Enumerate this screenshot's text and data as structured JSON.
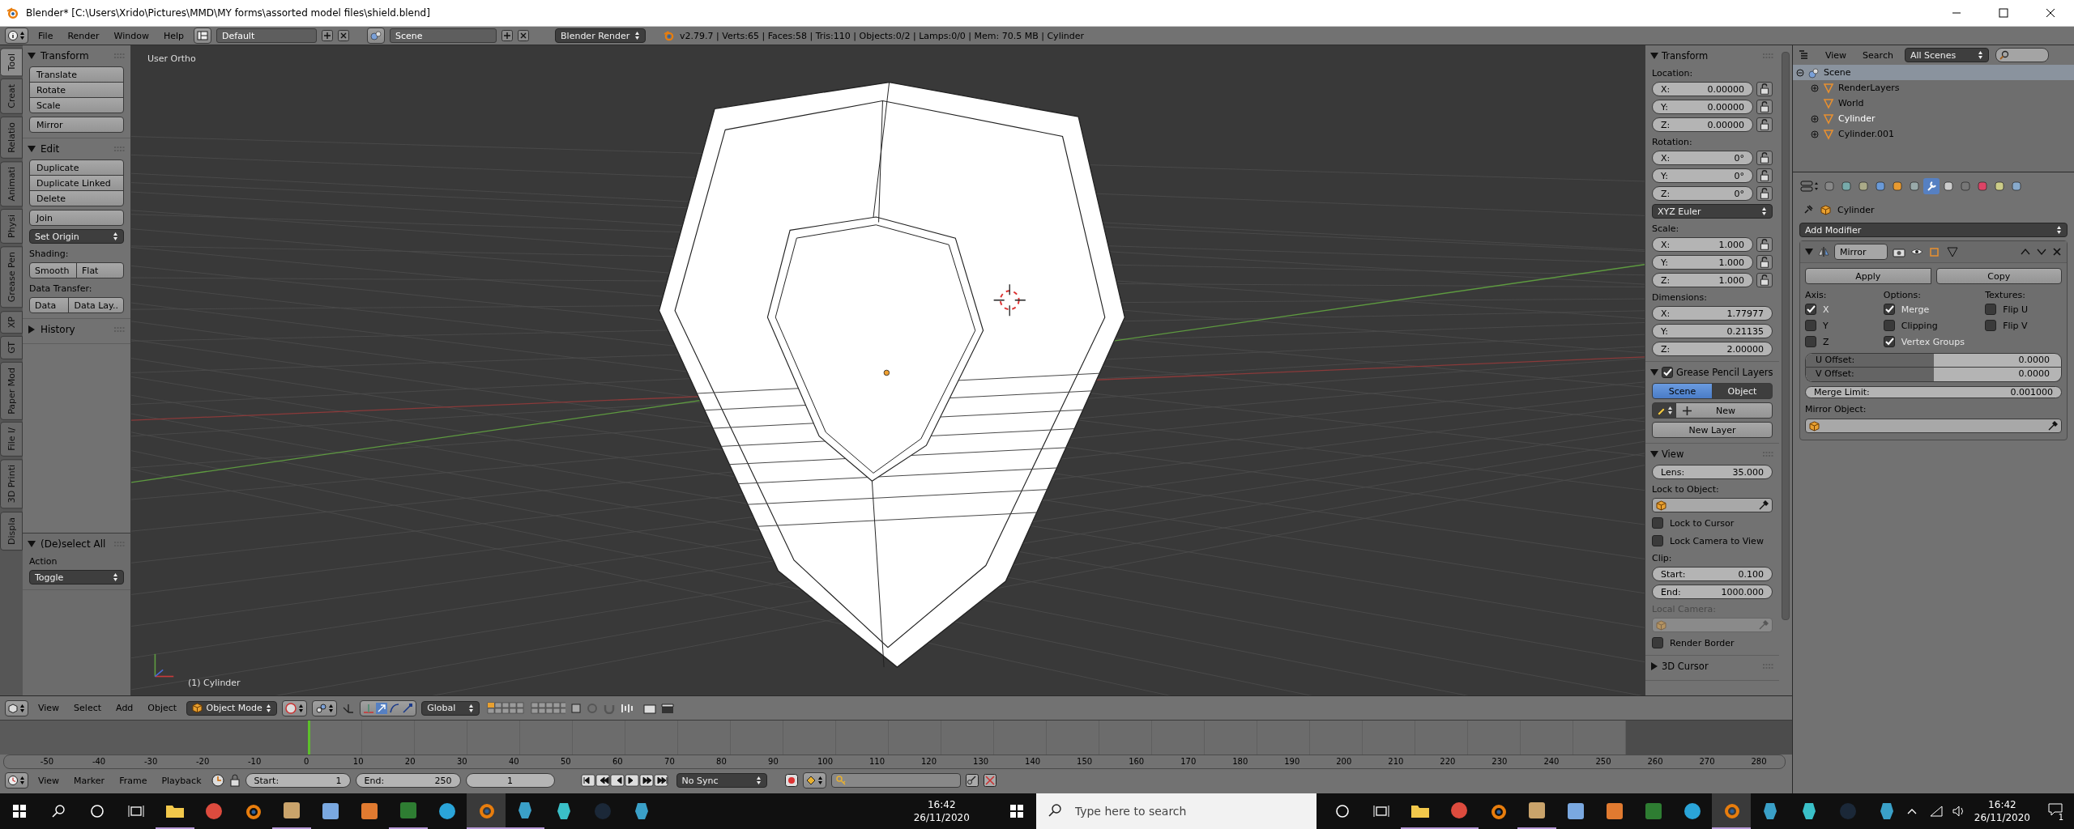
{
  "window": {
    "title": "Blender* [C:\\Users\\Xrido\\Pictures\\MMD\\MY forms\\assorted model files\\shield.blend]"
  },
  "info_header": {
    "menus": [
      "File",
      "Render",
      "Window",
      "Help"
    ],
    "layout": "Default",
    "scene": "Scene",
    "engine": "Blender Render",
    "stats": "v2.79.7 | Verts:65 | Faces:58 | Tris:110 | Objects:0/2 | Lamps:0/0 | Mem: 70.5 MB | Cylinder"
  },
  "tool_tabs": [
    {
      "label": "Tool",
      "selected": true
    },
    {
      "label": "Creat",
      "selected": false
    },
    {
      "label": "Relatio",
      "selected": false
    },
    {
      "label": "Animati",
      "selected": false
    },
    {
      "label": "Physi",
      "selected": false
    },
    {
      "label": "Grease Pen",
      "selected": false
    },
    {
      "label": "XP",
      "selected": false
    },
    {
      "label": "GT",
      "selected": false
    },
    {
      "label": "Paper Mod",
      "selected": false
    },
    {
      "label": "File I/",
      "selected": false
    },
    {
      "label": "3D Printi",
      "selected": false
    },
    {
      "label": "Displa",
      "selected": false
    }
  ],
  "tool_shelf": {
    "panels": [
      {
        "title": "Transform",
        "expanded": true,
        "rows": [
          {
            "kind": "stack",
            "buttons": [
              "Translate",
              "Rotate",
              "Scale"
            ]
          },
          {
            "kind": "button",
            "label": "Mirror"
          }
        ]
      },
      {
        "title": "Edit",
        "expanded": true,
        "rows": [
          {
            "kind": "stack",
            "buttons": [
              "Duplicate",
              "Duplicate Linked",
              "Delete"
            ]
          },
          {
            "kind": "button",
            "label": "Join"
          },
          {
            "kind": "dropdown",
            "label": "Set Origin"
          },
          {
            "kind": "label",
            "text": "Shading:"
          },
          {
            "kind": "pair",
            "buttons": [
              "Smooth",
              "Flat"
            ]
          },
          {
            "kind": "label",
            "text": "Data Transfer:"
          },
          {
            "kind": "pair",
            "buttons": [
              "Data",
              "Data Lay.."
            ]
          }
        ]
      },
      {
        "title": "History",
        "expanded": false
      }
    ],
    "operator": {
      "title": "(De)select All",
      "expanded": true,
      "rows": [
        {
          "kind": "label",
          "text": "Action"
        },
        {
          "kind": "dropdown",
          "label": "Toggle"
        }
      ]
    }
  },
  "viewport": {
    "view_name": "User Ortho",
    "object_info": "(1) Cylinder"
  },
  "n_panel": {
    "panels": [
      {
        "title": "Transform",
        "expanded": true,
        "rows": [
          {
            "kind": "label",
            "text": "Location:"
          },
          {
            "kind": "field",
            "label": "X:",
            "value": "0.00000",
            "locked": false
          },
          {
            "kind": "field",
            "label": "Y:",
            "value": "0.00000",
            "locked": false
          },
          {
            "kind": "field",
            "label": "Z:",
            "value": "0.00000",
            "locked": false
          },
          {
            "kind": "label",
            "text": "Rotation:"
          },
          {
            "kind": "field",
            "label": "X:",
            "value": "0°",
            "locked": false
          },
          {
            "kind": "field",
            "label": "Y:",
            "value": "0°",
            "locked": false
          },
          {
            "kind": "field",
            "label": "Z:",
            "value": "0°",
            "locked": false
          },
          {
            "kind": "dropdown",
            "label": "XYZ Euler"
          },
          {
            "kind": "label",
            "text": "Scale:"
          },
          {
            "kind": "field",
            "label": "X:",
            "value": "1.000",
            "locked": false
          },
          {
            "kind": "field",
            "label": "Y:",
            "value": "1.000",
            "locked": false
          },
          {
            "kind": "field",
            "label": "Z:",
            "value": "1.000",
            "locked": false
          },
          {
            "kind": "label",
            "text": "Dimensions:"
          },
          {
            "kind": "field",
            "label": "X:",
            "value": "1.77977"
          },
          {
            "kind": "field",
            "label": "Y:",
            "value": "0.21135"
          },
          {
            "kind": "field",
            "label": "Z:",
            "value": "2.00000"
          }
        ]
      },
      {
        "title": "Grease Pencil Layers",
        "expanded": true,
        "checked": true,
        "rows": [
          {
            "kind": "segmented",
            "options": [
              {
                "label": "Scene",
                "selected": true
              },
              {
                "label": "Object",
                "selected": false
              }
            ]
          },
          {
            "kind": "new",
            "label": "New"
          },
          {
            "kind": "button",
            "label": "New Layer"
          }
        ]
      },
      {
        "title": "View",
        "expanded": true,
        "rows": [
          {
            "kind": "field",
            "label": "Lens:",
            "value": "35.000"
          },
          {
            "kind": "label",
            "text": "Lock to Object:"
          },
          {
            "kind": "object",
            "disabled": false
          },
          {
            "kind": "checkbox",
            "label": "Lock to Cursor",
            "checked": false
          },
          {
            "kind": "checkbox",
            "label": "Lock Camera to View",
            "checked": false
          },
          {
            "kind": "label",
            "text": "Clip:"
          },
          {
            "kind": "field",
            "label": "Start:",
            "value": "0.100"
          },
          {
            "kind": "field",
            "label": "End:",
            "value": "1000.000"
          },
          {
            "kind": "label",
            "text": "Local Camera:",
            "disabled": true
          },
          {
            "kind": "object",
            "disabled": true
          },
          {
            "kind": "checkbox",
            "label": "Render Border",
            "checked": false
          }
        ]
      },
      {
        "title": "3D Cursor",
        "expanded": false
      }
    ]
  },
  "outliner": {
    "menus": [
      "View",
      "Search"
    ],
    "filter": "All Scenes",
    "tree": [
      {
        "label": "Scene",
        "selected": true,
        "active": false,
        "expanded": true,
        "children": [
          {
            "label": "RenderLayers",
            "selected": false,
            "active": false,
            "expanded": false
          },
          {
            "label": "World",
            "selected": false,
            "active": false
          },
          {
            "label": "Cylinder",
            "selected": false,
            "active": true,
            "expanded": false
          },
          {
            "label": "Cylinder.001",
            "selected": false,
            "active": false,
            "expanded": false
          }
        ]
      }
    ]
  },
  "properties": {
    "tabs": [
      {
        "selected": false
      },
      {
        "selected": false
      },
      {
        "selected": false
      },
      {
        "selected": false
      },
      {
        "selected": false
      },
      {
        "selected": false
      },
      {
        "selected": true
      },
      {
        "selected": false
      },
      {
        "selected": false
      },
      {
        "selected": false
      },
      {
        "selected": false
      },
      {
        "selected": false
      }
    ],
    "context": "Cylinder",
    "add_modifier": "Add Modifier",
    "modifier": {
      "name": "Mirror",
      "expanded": true,
      "apply": "Apply",
      "copy": "Copy",
      "axis_label": "Axis:",
      "options_label": "Options:",
      "textures_label": "Textures:",
      "axis": [
        {
          "label": "X",
          "checked": true
        },
        {
          "label": "Y",
          "checked": false
        },
        {
          "label": "Z",
          "checked": false
        }
      ],
      "options": [
        {
          "label": "Merge",
          "checked": true
        },
        {
          "label": "Clipping",
          "checked": false
        },
        {
          "label": "Vertex Groups",
          "checked": true
        }
      ],
      "textures": [
        {
          "label": "Flip U",
          "checked": false
        },
        {
          "label": "Flip V",
          "checked": false
        }
      ],
      "u_offset": {
        "label": "U Offset:",
        "value": "0.0000",
        "level": 0.5
      },
      "v_offset": {
        "label": "V Offset:",
        "value": "0.0000",
        "level": 0.5
      },
      "merge_limit": {
        "label": "Merge Limit:",
        "value": "0.001000"
      },
      "mirror_object_label": "Mirror Object:"
    }
  },
  "view3d_header": {
    "menus": [
      "View",
      "Select",
      "Add",
      "Object"
    ],
    "mode": "Object Mode",
    "orientation": "Global"
  },
  "timeline": {
    "ruler": [
      "-50",
      "-40",
      "-30",
      "-20",
      "-10",
      "0",
      "10",
      "20",
      "30",
      "40",
      "50",
      "60",
      "70",
      "80",
      "90",
      "100",
      "110",
      "120",
      "130",
      "140",
      "150",
      "160",
      "170",
      "180",
      "190",
      "200",
      "210",
      "220",
      "230",
      "240",
      "250",
      "260",
      "270",
      "280"
    ],
    "menus": [
      "View",
      "Marker",
      "Frame",
      "Playback"
    ],
    "start": {
      "label": "Start:",
      "value": "1"
    },
    "end": {
      "label": "End:",
      "value": "250"
    },
    "current": "1",
    "sync": "No Sync"
  },
  "taskbar_left": {
    "apps": [
      {
        "running": true,
        "active": false
      },
      {
        "running": false,
        "active": false
      },
      {
        "running": false,
        "active": false
      },
      {
        "running": true,
        "active": false
      },
      {
        "running": false,
        "active": false
      },
      {
        "running": false,
        "active": false
      },
      {
        "running": true,
        "active": false
      },
      {
        "running": false,
        "active": false
      },
      {
        "running": true,
        "active": true
      },
      {
        "running": true,
        "active": false
      },
      {
        "running": false,
        "active": false
      },
      {
        "running": false,
        "active": false
      },
      {
        "running": false,
        "active": false
      }
    ],
    "time": "16:42",
    "date": "26/11/2020"
  },
  "taskbar_right": {
    "search": {
      "placeholder": "Type here to search"
    },
    "apps": [
      {
        "running": true,
        "active": false
      },
      {
        "running": true,
        "active": false
      },
      {
        "running": false,
        "active": false
      },
      {
        "running": true,
        "active": false
      },
      {
        "running": false,
        "active": false
      },
      {
        "running": false,
        "active": false
      },
      {
        "running": false,
        "active": false
      },
      {
        "running": false,
        "active": false
      },
      {
        "running": true,
        "active": true
      },
      {
        "running": false,
        "active": false
      },
      {
        "running": false,
        "active": false
      },
      {
        "running": false,
        "active": false
      },
      {
        "running": false,
        "active": false
      }
    ],
    "time": "16:42",
    "date": "26/11/2020",
    "notifications": "1"
  }
}
